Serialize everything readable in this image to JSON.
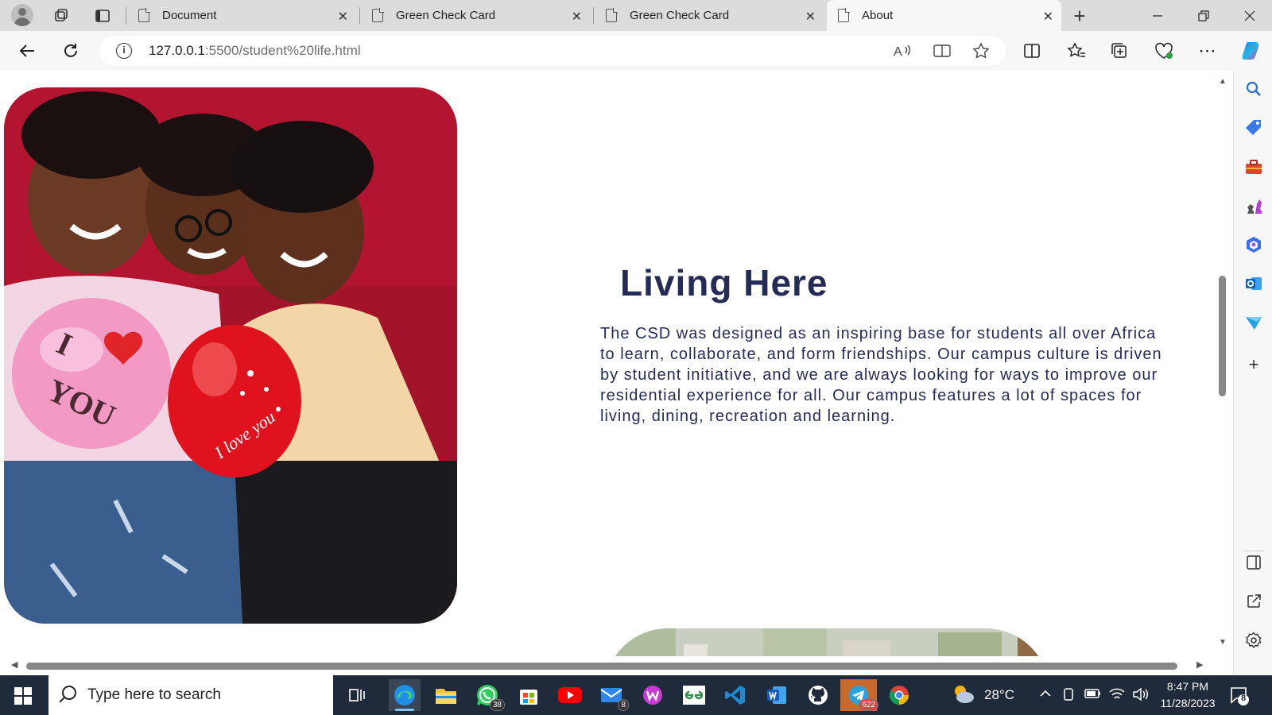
{
  "browser": {
    "tabs": [
      {
        "label": "Document"
      },
      {
        "label": "Green Check Card"
      },
      {
        "label": "Green Check Card"
      },
      {
        "label": "About",
        "active": true
      }
    ],
    "url_host": "127.0.0.1",
    "url_rest": ":5500/student%20life.html",
    "new_tab_glyph": "+",
    "icons": [
      "profile-icon",
      "workspaces-icon",
      "tab-actions-icon",
      "back-icon",
      "refresh-icon",
      "info-icon",
      "read-aloud-icon",
      "immersive-reader-icon",
      "favorite-icon",
      "split-screen-icon",
      "favorites-icon",
      "collections-icon",
      "browser-essentials-icon",
      "more-icon",
      "copilot-icon"
    ]
  },
  "page": {
    "heading": "Living Here",
    "paragraph": "The CSD was designed as an inspiring base for students all over Africa to learn, collaborate, and form friendships. Our campus culture is driven by student initiative, and we are always looking for ways to improve our residential experience for all. Our campus features a lot of spaces for living, dining, recreation and learning.",
    "image_balloon_text": "I YOU",
    "image_balloon_text_2": "I love you"
  },
  "sidebar": {
    "icons": [
      "search-icon",
      "shopping-icon",
      "tools-icon",
      "games-icon",
      "microsoft-365-icon",
      "outlook-icon",
      "drop-icon",
      "add-icon",
      "hide-sidebar-icon",
      "external-link-icon",
      "settings-icon"
    ]
  },
  "taskbar": {
    "search_placeholder": "Type here to search",
    "apps": [
      {
        "name": "task-view"
      },
      {
        "name": "edge",
        "active": true
      },
      {
        "name": "file-explorer"
      },
      {
        "name": "whatsapp",
        "badge": "38"
      },
      {
        "name": "microsoft-store"
      },
      {
        "name": "youtube"
      },
      {
        "name": "mail",
        "badge": "8"
      },
      {
        "name": "wps"
      },
      {
        "name": "geeksforgeeks"
      },
      {
        "name": "vscode"
      },
      {
        "name": "word"
      },
      {
        "name": "github"
      },
      {
        "name": "telegram",
        "badge": "622"
      },
      {
        "name": "chrome"
      }
    ],
    "weather": "28°C",
    "time": "8:47 PM",
    "date": "11/28/2023",
    "notification_count": "8"
  },
  "colors": {
    "heading": "#252b57",
    "taskbar": "#1f2b3a",
    "tabstrip": "#dcdcdc"
  }
}
